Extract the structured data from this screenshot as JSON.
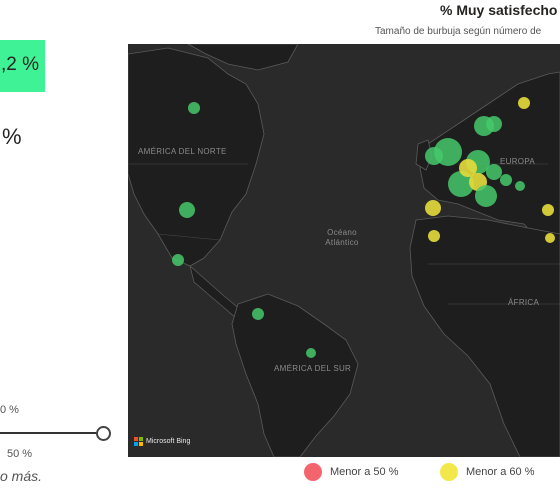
{
  "left_panel": {
    "kpi_value": ",2 %",
    "pct_symbol": "%",
    "slider_tick_label": "0 %",
    "slider_min_label": "50 %",
    "note": "o más."
  },
  "map_visual": {
    "title": "% Muy satisfecho",
    "subtitle": "Tamaño de burbuja según número de",
    "labels": {
      "north_america": "AMÉRICA DEL NORTE",
      "south_america": "AMÉRICA DEL SUR",
      "europe": "EUROPA",
      "africa": "ÁFRICA",
      "ocean": "Océano Atlántico"
    },
    "attribution": "Microsoft Bing",
    "legend": [
      {
        "label": "Menor a 50 %",
        "color": "#f4646c"
      },
      {
        "label": "Menor a 60 %",
        "color": "#f2e84a"
      }
    ],
    "colors": {
      "green_bubble": "#45c96b",
      "yellow_bubble": "#e6dc3c",
      "kpi_background": "#3ff295",
      "map_background": "#2a2a2a"
    }
  }
}
